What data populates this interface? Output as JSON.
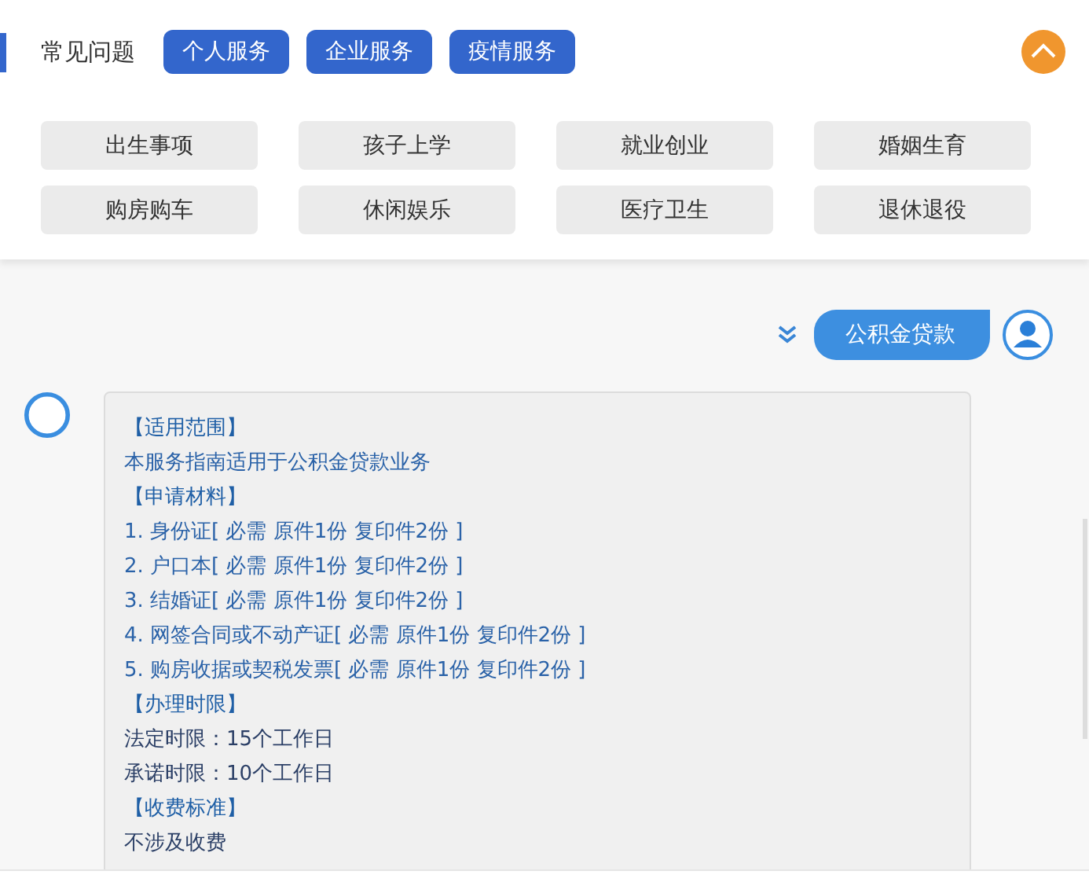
{
  "header": {
    "title": "常见问题",
    "tabs": [
      {
        "label": "个人服务"
      },
      {
        "label": "企业服务"
      },
      {
        "label": "疫情服务"
      }
    ]
  },
  "topics": [
    "出生事项",
    "孩子上学",
    "就业创业",
    "婚姻生育",
    "购房购车",
    "休闲娱乐",
    "医疗卫生",
    "退休退役"
  ],
  "user_message": {
    "text": "公积金贷款"
  },
  "answer": [
    {
      "kind": "heading",
      "text": "【适用范围】"
    },
    {
      "kind": "item",
      "text": "本服务指南适用于公积金贷款业务"
    },
    {
      "kind": "heading",
      "text": "【申请材料】"
    },
    {
      "kind": "item",
      "text": "1. 身份证[ 必需 原件1份 复印件2份 ]"
    },
    {
      "kind": "item",
      "text": "2. 户口本[ 必需 原件1份 复印件2份 ]"
    },
    {
      "kind": "item",
      "text": "3. 结婚证[ 必需 原件1份 复印件2份 ]"
    },
    {
      "kind": "item",
      "text": "4. 网签合同或不动产证[ 必需 原件1份 复印件2份 ]"
    },
    {
      "kind": "item",
      "text": "5. 购房收据或契税发票[ 必需 原件1份 复印件2份 ]"
    },
    {
      "kind": "heading",
      "text": "【办理时限】"
    },
    {
      "kind": "text",
      "text": "法定时限：15个工作日"
    },
    {
      "kind": "text",
      "text": "承诺时限：10个工作日"
    },
    {
      "kind": "heading",
      "text": "【收费标准】"
    },
    {
      "kind": "text",
      "text": "不涉及收费"
    }
  ]
}
